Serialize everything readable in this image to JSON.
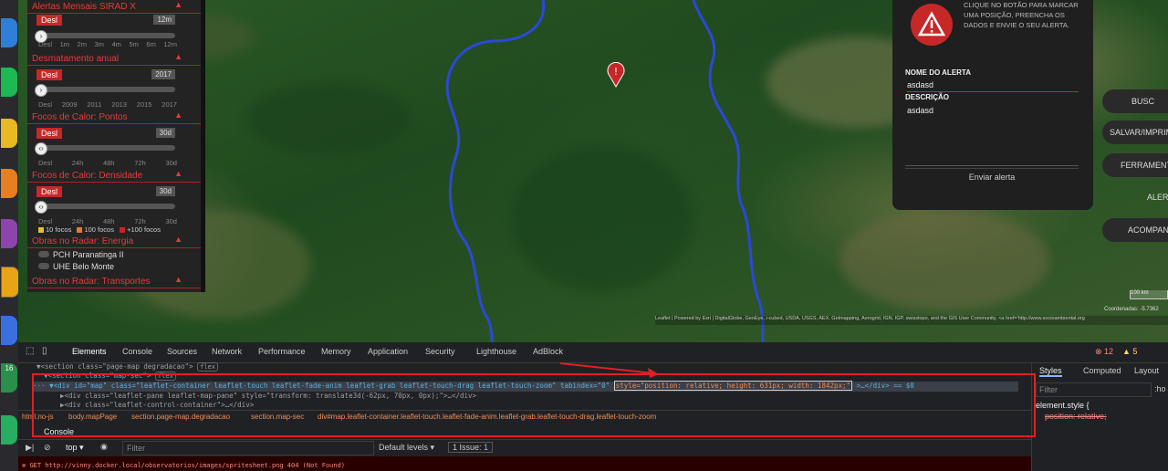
{
  "layers": {
    "sec0_title": "Alertas Mensais SIRAD X",
    "sec0_value": "12m",
    "sec0_ticks": [
      "Desl",
      "1m",
      "2m",
      "3m",
      "4m",
      "5m",
      "6m",
      "12m"
    ],
    "sec1_title": "Desmatamento anual",
    "sec1_value": "2017",
    "sec1_ticks": [
      "Desl",
      "2009",
      "2011",
      "2013",
      "2015",
      "2017"
    ],
    "sec2_title": "Focos de Calor: Pontos",
    "sec2_value": "30d",
    "sec2_ticks": [
      "Desl",
      "24h",
      "48h",
      "72h",
      "30d"
    ],
    "sec3_title": "Focos de Calor: Densidade",
    "sec3_value": "30d",
    "sec3_ticks": [
      "Desl",
      "24h",
      "48h",
      "72h",
      "30d"
    ],
    "sec3_legend": [
      "10 focos",
      "100 focos",
      "+100 focos"
    ],
    "sec4_title": "Obras no Radar: Energia",
    "sec4_items": [
      "PCH Paranatinga II",
      "UHE Belo Monte"
    ],
    "sec5_title": "Obras no Radar: Transportes",
    "desl_label": "Desl"
  },
  "alert": {
    "hint": "CLIQUE NO BOTÃO PARA MARCAR UMA POSIÇÃO, PREENCHA OS DADOS E ENVIE O SEU ALERTA.",
    "name_label": "NOME DO ALERTA",
    "name_value": "asdasd",
    "desc_label": "DESCRIÇÃO",
    "desc_value": "asdasd",
    "send_label": "Enviar alerta"
  },
  "right_buttons": [
    "BUSC",
    "SALVAR/IMPRIM",
    "FERRAMENTA",
    "ALERT",
    "ACOMPANH"
  ],
  "map": {
    "scale": "100 km",
    "coords": "Coordenadas: -5.7362",
    "attribution": "Leaflet | Powered by Esri | DigitalGlobe, GeoEye, i-cubed, USDA, USGS, AEX, Getmapping, Aerogrid, IGN, IGP, swisstopo, and the GIS User Community, <a href='http://www.socioambiental.org"
  },
  "devtools": {
    "tabs": [
      "Elements",
      "Console",
      "Sources",
      "Network",
      "Performance",
      "Memory",
      "Application",
      "Security",
      "Lighthouse",
      "AdBlock"
    ],
    "errors": "12",
    "warnings": "5",
    "line1": "▼<section class=\"page-map degradacao\">",
    "line1_badge": "flex",
    "line2": "▼<section class=\"map-sec\">",
    "line2_badge": "flex",
    "line3_a": "▼<div id=\"map\" class=\"leaflet-container leaflet-touch leaflet-fade-anim leaflet-grab leaflet-touch-drag leaflet-touch-zoom\" tabindex=\"0\"",
    "line3_b": "style=\"position: relative; height: 631px; width: 1842px;\"",
    "line3_c": ">…</div> == $0",
    "line4": "▶<div class=\"leaflet-pane leaflet-map-pane\" style=\"transform: translate3d(-62px, 70px, 0px);\">…</div>",
    "line5": "▶<div class=\"leaflet-control-container\">…</div>",
    "crumbs": [
      "html.no-js",
      "body.mapPage",
      "section.page-map.degradacao",
      "section.map-sec",
      "div#map.leaflet-container.leaflet-touch.leaflet-fade-anim.leaflet-grab.leaflet-touch-drag.leaflet-touch-zoom"
    ],
    "console_tab": "Console",
    "context": "top",
    "filter_placeholder": "Filter",
    "levels": "Default levels",
    "issues": "1 Issue:",
    "issue_count": "1",
    "msg1": "GET http://vinny.docker.local/observatorios/images/spritesheet.png 404 (Not Found)",
    "styles_tabs": [
      "Styles",
      "Computed",
      "Layout"
    ],
    "styles_filter": "Filter",
    "styles_hov": ":ho",
    "element_style": "element.style {",
    "prop1": "position: relative;"
  }
}
